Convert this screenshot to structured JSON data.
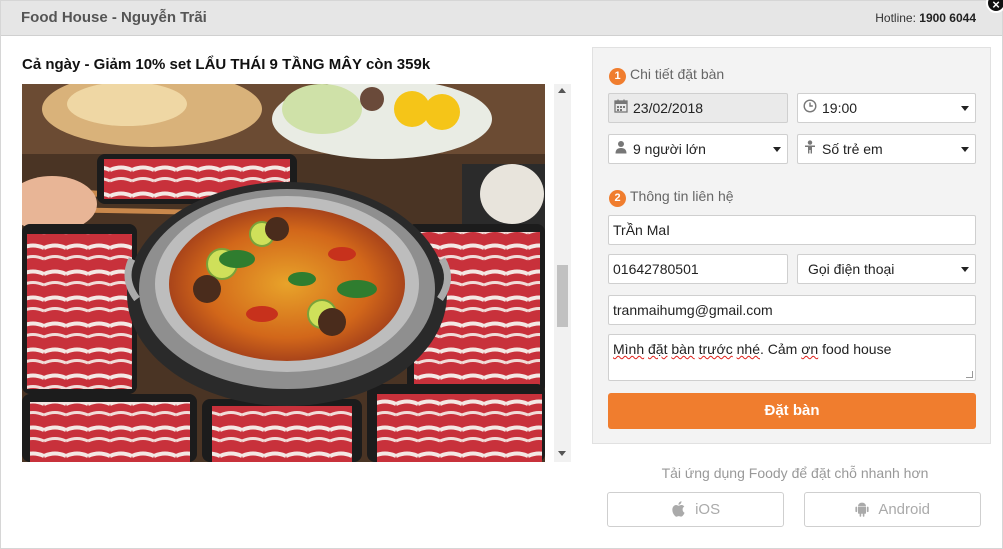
{
  "header": {
    "title": "Food House - Nguyễn Trãi",
    "hotline_label": "Hotline:",
    "hotline_number": "1900 6044",
    "close_label": "×"
  },
  "promo": {
    "title": "Cả ngày - Giảm 10% set LẨU THÁI 9 TẦNG MÂY còn 359k"
  },
  "booking": {
    "step1": {
      "number": "1",
      "label": "Chi tiết đặt bàn"
    },
    "date": "23/02/2018",
    "time": "19:00",
    "adults": "9 người lớn",
    "children_placeholder": "Số trẻ em",
    "step2": {
      "number": "2",
      "label": "Thông tin liên hệ"
    },
    "name": "TrẦn MaI",
    "phone": "01642780501",
    "contact_method": "Gọi điện thoại",
    "email": "tranmaihumg@gmail.com",
    "note_parts": [
      "Mình",
      " ",
      "đặt",
      " ",
      "bàn",
      " ",
      "trước",
      " ",
      "nhé",
      ". Cảm ",
      "ơn",
      " food house"
    ],
    "submit_label": "Đặt bàn"
  },
  "apps": {
    "caption": "Tải ứng dụng Foody để đặt chỗ nhanh hơn",
    "ios_label": "iOS",
    "android_label": "Android"
  },
  "colors": {
    "accent": "#f07d2e",
    "header_bg": "#e6e6e6",
    "panel_bg": "#f3f3f3"
  }
}
